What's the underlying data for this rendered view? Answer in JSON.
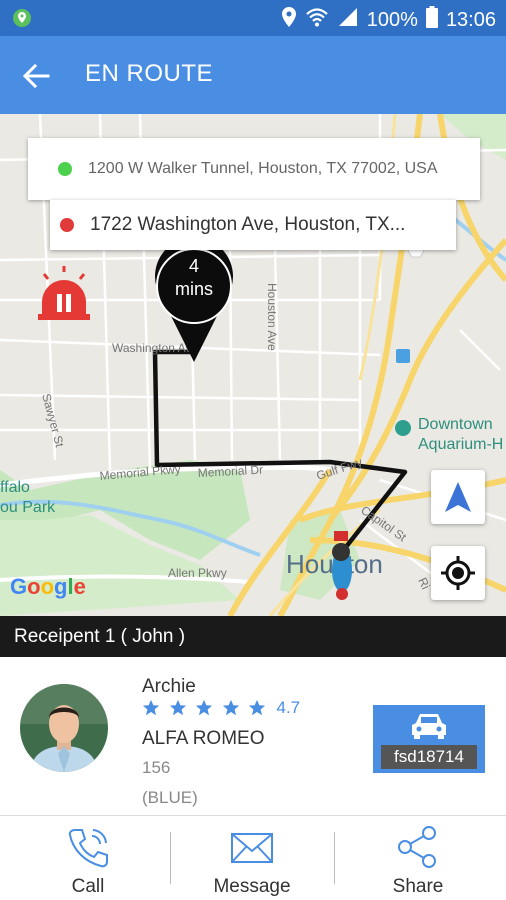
{
  "status_bar": {
    "battery": "100%",
    "time": "13:06",
    "icons": [
      "location-badge-icon",
      "location-pin-icon",
      "wifi-icon",
      "signal-icon",
      "battery-icon"
    ]
  },
  "header": {
    "title": "EN ROUTE",
    "back_icon": "arrow-back-icon"
  },
  "map": {
    "pickup_address": "1200 W Walker Tunnel, Houston, TX 77002, USA",
    "dropoff_address": "1722 Washington Ave, Houston, TX...",
    "eta": {
      "value": "4",
      "unit": "mins"
    },
    "labels": {
      "washington": "Washington Ave",
      "houston_ave": "Houston Ave",
      "sawyer": "Sawyer St",
      "memorial1": "Memorial Pkwy",
      "memorial2": "Memorial Dr",
      "gulf": "Gulf Fwy",
      "capitol": "Capitol St",
      "allen": "Allen Pkwy",
      "downtown1": "Downtown",
      "downtown2": "Aquarium-H",
      "buffalo1": "ffalo",
      "buffalo2": "ou Park",
      "city": "Houston",
      "ri": "Ri",
      "google": "Google"
    },
    "colors": {
      "route": "#111111",
      "pickup": "#4bd14b",
      "dropoff": "#e03a3a",
      "alarm": "#e53935",
      "navigate": "#3b73d6"
    }
  },
  "recipient": {
    "label": "Receipent 1 ( John )"
  },
  "driver": {
    "name": "Archie",
    "rating": "4.7",
    "stars": 5,
    "car_model": "ALFA ROMEO",
    "car_number": "156",
    "car_color": "(BLUE)",
    "plate": "fsd18714"
  },
  "actions": [
    {
      "label": "Call",
      "icon": "phone-icon"
    },
    {
      "label": "Message",
      "icon": "envelope-icon"
    },
    {
      "label": "Share",
      "icon": "share-icon"
    }
  ],
  "accent_color": "#4a8ee4"
}
